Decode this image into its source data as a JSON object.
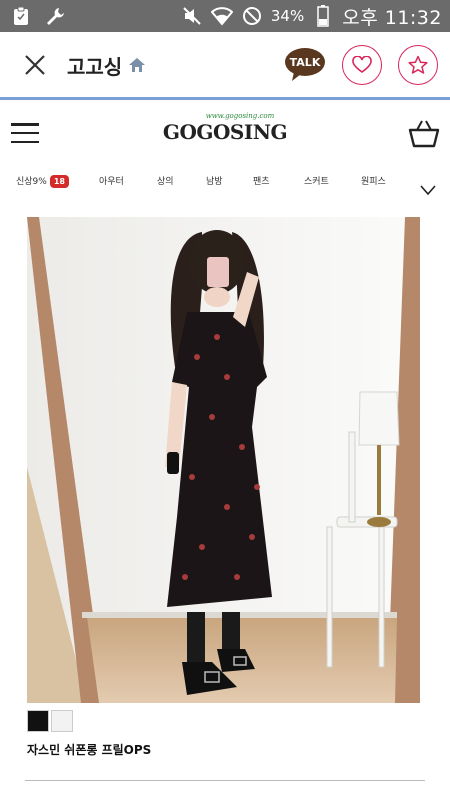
{
  "status_bar": {
    "battery": "34%",
    "time": "오후 11:32",
    "icons": [
      "clipboard-icon",
      "wrench-icon",
      "mute-icon",
      "wifi-icon",
      "do-not-disturb-icon",
      "battery-icon"
    ]
  },
  "header": {
    "title": "고고싱",
    "talk_label": "TALK",
    "icons": [
      "close-icon",
      "home-icon",
      "heart-icon",
      "star-icon"
    ]
  },
  "site": {
    "logo": "GOGOSING",
    "logo_tagline": "www.gogosing.com",
    "icons": [
      "menu-icon",
      "cart-icon"
    ]
  },
  "categories": {
    "items": [
      "신상9%",
      "아우터",
      "상의",
      "남방",
      "팬츠",
      "스커트",
      "원피스"
    ],
    "new_badge": "18"
  },
  "product": {
    "name": "자스민 쉬폰롱 프릴OPS",
    "colors": [
      "#111111",
      "#f2f2f2"
    ]
  },
  "colors": {
    "status_bar": "#6b6b6b",
    "accent_pink": "#d8265a",
    "badge_red": "#d42a2a",
    "header_line": "#7aa0d8",
    "talk_brown": "#5a3820"
  }
}
